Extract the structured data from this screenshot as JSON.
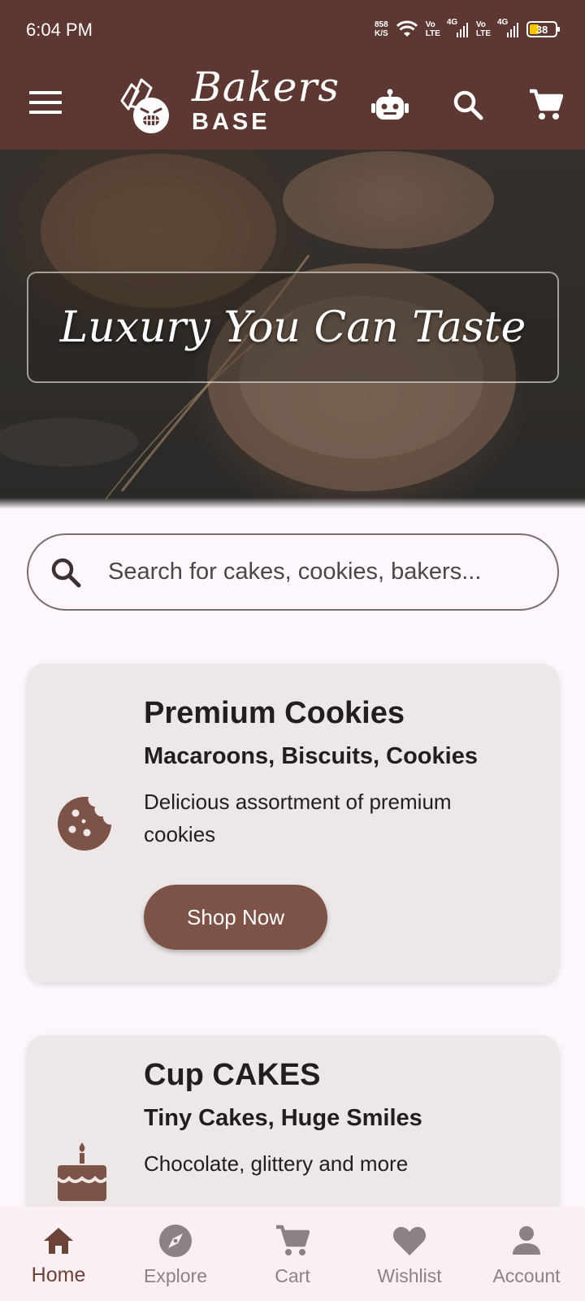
{
  "status_bar": {
    "time": "6:04 PM",
    "net_speed_value": "858",
    "net_speed_unit": "K/S",
    "sim1_vo": "Vo",
    "sim1_lte": "LTE",
    "sim1_network": "4G",
    "sim2_vo": "Vo",
    "sim2_lte": "LTE",
    "sim2_network": "4G",
    "battery": "38",
    "battery_level": 0.38
  },
  "app_bar": {
    "brand_script": "Bakers",
    "brand_sub": "BASE",
    "icons": [
      "menu-icon",
      "logo-icon",
      "chatbot-icon",
      "search-icon",
      "cart-icon"
    ]
  },
  "hero": {
    "tagline": "Luxury You Can Taste"
  },
  "search": {
    "placeholder": "Search for cakes, cookies, bakers..."
  },
  "categories": [
    {
      "title": "Premium Cookies",
      "subtitle": "Macaroons, Biscuits, Cookies",
      "description": "Delicious assortment of premium cookies",
      "button": "Shop Now",
      "icon": "cookie-icon"
    },
    {
      "title": "Cup CAKES",
      "subtitle": "Tiny Cakes, Huge Smiles",
      "description": "Chocolate, glittery and more",
      "icon": "cake-icon"
    }
  ],
  "bottom_nav": {
    "items": [
      {
        "label": "Home",
        "icon": "home-icon",
        "active": true
      },
      {
        "label": "Explore",
        "icon": "compass-icon",
        "active": false
      },
      {
        "label": "Cart",
        "icon": "cart-icon",
        "active": false
      },
      {
        "label": "Wishlist",
        "icon": "heart-icon",
        "active": false
      },
      {
        "label": "Account",
        "icon": "person-icon",
        "active": false
      }
    ]
  },
  "colors": {
    "primary": "#5d3832",
    "accent": "#7d5247",
    "card_bg": "#ede8e7",
    "page_bg": "#fdf7fd"
  }
}
